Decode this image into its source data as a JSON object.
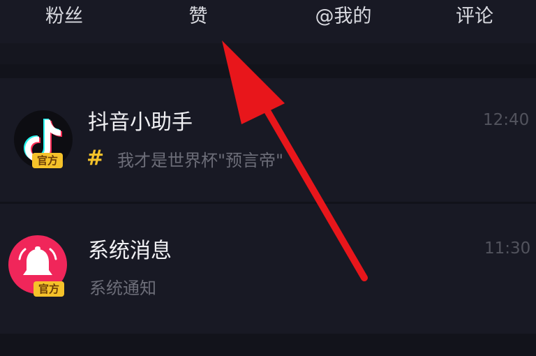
{
  "tabs": [
    {
      "label": "粉丝"
    },
    {
      "label": "赞"
    },
    {
      "label": "@我的"
    },
    {
      "label": "评论"
    }
  ],
  "messages": [
    {
      "title": "抖音小助手",
      "hash": "#",
      "subtitle": "我才是世界杯\"预言帝\"",
      "time": "12:40",
      "badge": "官方",
      "icon": "tiktok-logo"
    },
    {
      "title": "系统消息",
      "subtitle": "系统通知",
      "time": "11:30",
      "badge": "官方",
      "icon": "bell-icon"
    }
  ],
  "colors": {
    "background": "#15161f",
    "arrow": "#e8161b",
    "badge": "#f5c22a",
    "system_avatar": "#f0265a"
  }
}
